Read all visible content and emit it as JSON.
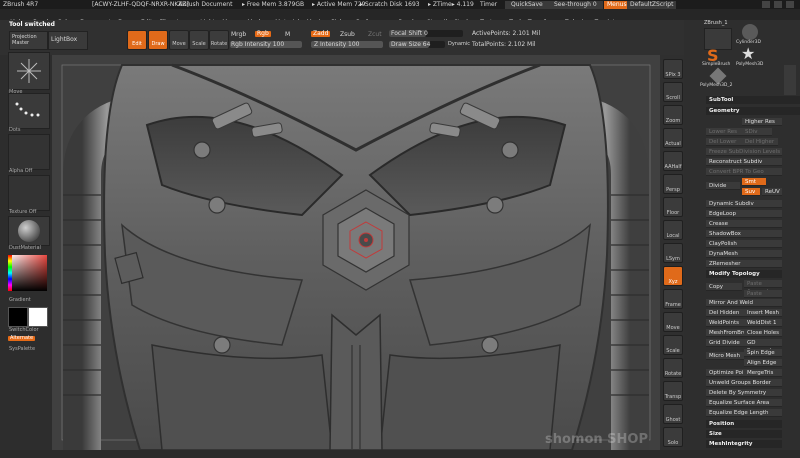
{
  "title_bar": {
    "app": "ZBrush 4R7",
    "id_text": "[ACWY-ZLHF-QDQF-NRXR-NKAZ]",
    "doc": "ZBrush Document",
    "free_mem": "▸ Free Mem 3.879GB",
    "active_mem": "▸ Active Mem 729",
    "scratch": "▸ Scratch Disk 1693",
    "ztime": "▸ ZTime▸ 4.119",
    "timer": "Timer",
    "quicksave": "QuickSave",
    "seethrough": "See-through 0",
    "menus": "Menus",
    "script": "DefaultZScript"
  },
  "menu_bar": [
    "Alpha",
    "Brush",
    "Color",
    "Document",
    "Draw",
    "Edit",
    "File",
    "Layer",
    "Light",
    "Macro",
    "Marker",
    "Material",
    "Movie",
    "Picker",
    "Preferences",
    "Render",
    "Stencil",
    "Stroke",
    "Texture",
    "Tool",
    "Transform",
    "Zplugin",
    "Zscript"
  ],
  "toolbar": {
    "tool_switched": "Tool switched",
    "projection_master": "Projection Master",
    "lightbox": "LightBox",
    "edit": "Edit",
    "draw": "Draw",
    "move": "Move",
    "scale": "Scale",
    "rotate": "Rotate",
    "mrgb": "Mrgb",
    "rgb": "Rgb",
    "m": "M",
    "rgb_intensity": "Rgb Intensity 100",
    "zadd": "Zadd",
    "zsub": "Zsub",
    "zcut": "Zcut",
    "z_intensity": "Z Intensity 100",
    "focal_shift": "Focal Shift 0",
    "draw_size": "Draw Size 64",
    "dynamic": "Dynamic",
    "active_points": "ActivePoints: 2.101 Mil",
    "total_points": "TotalPoints: 2.102 Mil"
  },
  "left_shelf": {
    "move_label": "Move",
    "stroke_label": "Dots",
    "alpha_label": "Alpha Off",
    "texture_label": "Texture Off",
    "material_label": "DustMaterial",
    "gradient": "Gradient",
    "switch_color": "SwitchColor",
    "alternate": "Alternate",
    "syspalette": "SysPalette",
    "main_color": "#e8473f"
  },
  "right_shelf": [
    "SPix 3",
    "Scroll",
    "Zoom",
    "Actual",
    "AAHalf",
    "Persp",
    "Floor",
    "Local",
    "LSym",
    "Xyz",
    "Frame",
    "Move",
    "Scale",
    "Rotate",
    "Transp",
    "Ghost",
    "Solo"
  ],
  "subtool_thumbs": {
    "top_label": "ZBrush_1",
    "thumb1": "Cylinder3D",
    "thumb2": "PolyMesh3D",
    "thumb3": "SimpleBrush",
    "thumb4": "PolyMesh3D_2",
    "thumb5": "PolyMesh3D_3"
  },
  "panel": {
    "subtool": "SubTool",
    "geometry": "Geometry",
    "higher_res": "Higher Res",
    "lower_res": "Lower Res",
    "sdiv": "SDiv",
    "del_lower": "Del Lower",
    "del_higher": "Del Higher",
    "freeze_subdiv": "Freeze SubDivision Levels",
    "reconstruct": "Reconstruct Subdiv",
    "convert_bpr": "Convert BPR To Geo",
    "divide": "Divide",
    "smt": "Smt",
    "suv": "Suv",
    "relax": "ReUV",
    "dynamic_subdiv": "Dynamic Subdiv",
    "edgeloop": "EdgeLoop",
    "crease": "Crease",
    "shadowbox": "ShadowBox",
    "claypolish": "ClayPolish",
    "dynamesh": "DynaMesh",
    "zremesher": "ZRemesher",
    "modify_topology": "Modify Topology",
    "copy": "Copy",
    "paste_append": "Paste Append",
    "paste_replace": "Paste Replace",
    "mirror_weld": "Mirror And Weld",
    "del_hidden": "Del Hidden",
    "insert_mesh": "Insert Mesh",
    "weldpoints": "WeldPoints",
    "weld_dist": "WeldDist 1",
    "meshfromb": "MeshFromBrush",
    "close_holes": "Close Holes",
    "grid_divide": "Grid Divide",
    "gd_segments": "GD Segments",
    "micro_mesh": "Micro Mesh",
    "spin_edge": "Spin Edge",
    "align_edge": "Align Edge",
    "optimize": "Optimize Poi",
    "merge_tris": "MergeTris",
    "unweld_groups": "Unweld Groups Border",
    "delete_symmetry": "Delete By Symmetry",
    "equalize_surface": "Equalize Surface Area",
    "equalize_edge": "Equalize Edge Length",
    "position": "Position",
    "size": "Size",
    "mesh_integrity": "MeshIntegrity"
  },
  "watermark": "shomon SHOP"
}
